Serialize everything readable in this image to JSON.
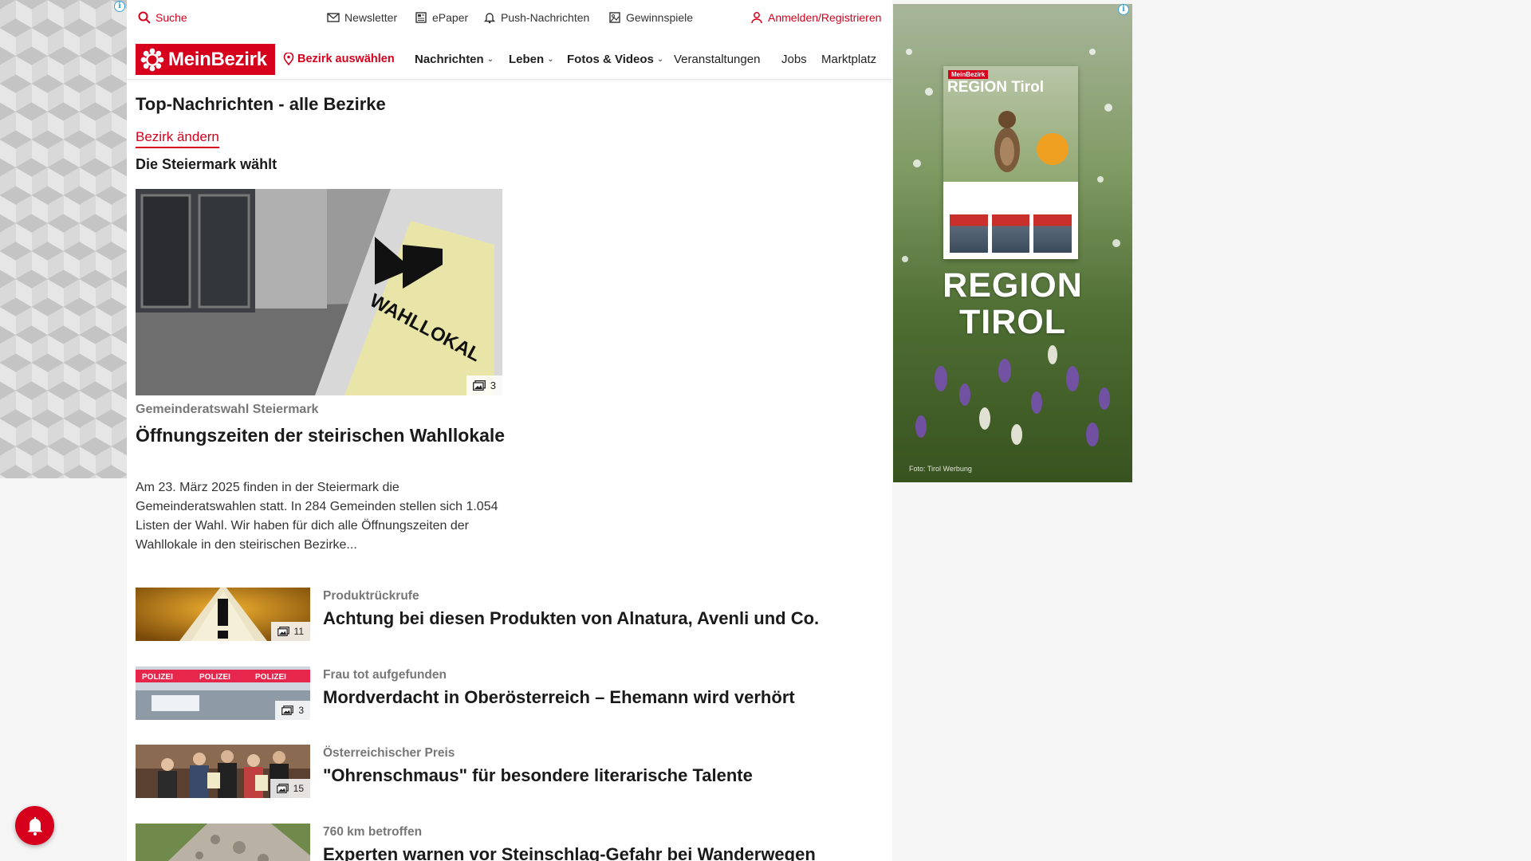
{
  "topbar": {
    "search_label": "Suche",
    "newsletter_label": "Newsletter",
    "epaper_label": "ePaper",
    "push_label": "Push-Nachrichten",
    "gewinnspiele_label": "Gewinnspiele",
    "login_label": "Anmelden/Registrieren"
  },
  "nav": {
    "logo_text": "MeinBezirk",
    "bezirk_label": "Bezirk auswählen",
    "items": [
      {
        "label": "Nachrichten"
      },
      {
        "label": "Leben"
      },
      {
        "label": "Fotos & Videos"
      },
      {
        "label": "Veranstaltungen"
      },
      {
        "label": "Jobs"
      },
      {
        "label": "Marktplatz"
      }
    ]
  },
  "page": {
    "title": "Top-Nachrichten - alle Bezirke",
    "change_link": "Bezirk ändern",
    "section_heading": "Die Steiermark wählt"
  },
  "hero": {
    "image_count": "3",
    "kicker": "Gemeinderatswahl Steiermark",
    "title": "Öffnungszeiten der steirischen Wahllokale",
    "teaser": "Am 23. März 2025 finden in der Steiermark die Gemeinderatswahlen statt. In 284 Gemeinden stellen sich 1.054 Listen der Wahl. Wir haben für dich alle Öffnungszeiten der Wahllokale in den steirischen Bezirke...",
    "sign_text": "WAHLLOKAL"
  },
  "articles": [
    {
      "kicker": "Produktrückrufe",
      "title": "Achtung bei diesen Produkten von Alnatura, Avenli und Co.",
      "image_count": "11"
    },
    {
      "kicker": "Frau tot aufgefunden",
      "title": "Mordverdacht in Oberösterreich – Ehemann wird verhört",
      "image_count": "3",
      "tape_text": "POLIZEI"
    },
    {
      "kicker": "Österreichischer Preis",
      "title": "\"Ohrenschmaus\" für besondere literarische Talente",
      "image_count": "15"
    },
    {
      "kicker": "760 km betroffen",
      "title": "Experten warnen vor Steinschlag-Gefahr bei Wanderwegen"
    }
  ],
  "ad": {
    "mag_brand": "MeinBezirk",
    "mag_title": "REGION Tirol",
    "headline_line1": "REGION",
    "headline_line2": "TIROL",
    "photo_credit": "Foto: Tirol Werbung",
    "info_glyph": "i"
  },
  "colors": {
    "brand_red": "#d6001c",
    "text_dark": "#1a1a1a",
    "kicker_gray": "#777777"
  },
  "icons": {
    "search": "search-icon",
    "newsletter": "envelope-icon",
    "epaper": "newspaper-icon",
    "push": "bell-icon",
    "gewinnspiele": "gift-icon",
    "login": "user-icon",
    "bezirk": "map-pin-icon",
    "images": "image-gallery-icon",
    "notification": "notification-bell-icon"
  }
}
